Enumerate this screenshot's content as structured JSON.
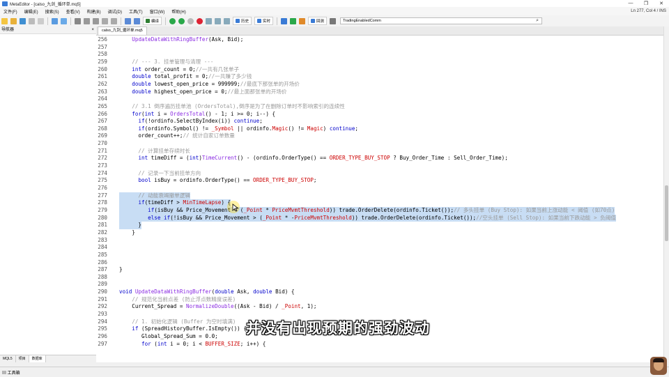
{
  "window": {
    "title": "MetaEditor - [calso_九剑_循环单.mq5]",
    "controls": [
      "—",
      "❐",
      "✕"
    ]
  },
  "menu": {
    "items": [
      "文件(F)",
      "编辑(E)",
      "搜索(S)",
      "查看(V)",
      "构建(B)",
      "调试(D)",
      "工具(T)",
      "窗口(W)",
      "帮助(H)"
    ],
    "cursor_status": "Ln 277, Col 4  /  INS"
  },
  "toolbar": {
    "compile_label": "编译",
    "history_label": "历史",
    "realtime_label": "实时",
    "trade_label": "回测",
    "search_value": "TradingEnabledComm"
  },
  "navigator": {
    "title": "导航器",
    "tabs": [
      "MQL5",
      "项目",
      "数据库"
    ]
  },
  "editor": {
    "tab_label": "calso_九剑_循环单.mq5",
    "lines": [
      {
        "n": "256",
        "t": "    UpdateDataWithRingBuffer(Ask, Bid);",
        "cls": ""
      },
      {
        "n": "257",
        "t": "",
        "cls": ""
      },
      {
        "n": "258",
        "t": "",
        "cls": ""
      },
      {
        "n": "259",
        "t": "    // --- 3. 挂单管理与清理 ---",
        "cls": "c"
      },
      {
        "n": "260",
        "t": "    int order_count = 0;//一共有几张单子",
        "cls": "mix1"
      },
      {
        "n": "261",
        "t": "    double total_profit = 0;//一共赚了多少钱",
        "cls": "mix2"
      },
      {
        "n": "262",
        "t": "    double lowest_open_price = 999999;//最底下那张单的开场价",
        "cls": "mix3"
      },
      {
        "n": "263",
        "t": "    double highest_open_price = 0;//最上面那张单的开场价",
        "cls": "mix4"
      },
      {
        "n": "264",
        "t": "",
        "cls": ""
      },
      {
        "n": "265",
        "t": "    // 3.1 倒序遍历挂单池 (OrdersTotal),倒序是为了在删除订单时不影响索引的连续性",
        "cls": "c"
      },
      {
        "n": "266",
        "t": "    for(int i = OrdersTotal() - 1; i >= 0; i--) {",
        "cls": "mix5"
      },
      {
        "n": "267",
        "t": "      if(!ordinfo.SelectByIndex(i)) continue;",
        "cls": "mix6"
      },
      {
        "n": "268",
        "t": "      if(ordinfo.Symbol() != _Symbol || ordinfo.Magic() != Magic) continue;",
        "cls": "mix7"
      },
      {
        "n": "269",
        "t": "      order_count++;// 统计自家订单数量",
        "cls": "mix8"
      },
      {
        "n": "270",
        "t": "",
        "cls": ""
      },
      {
        "n": "271",
        "t": "      // 计算挂单存续时长",
        "cls": "c"
      },
      {
        "n": "272",
        "t": "      int timeDiff = (int)TimeCurrent() - (ordinfo.OrderType() == ORDER_TYPE_BUY_STOP ? Buy_Order_Time : Sell_Order_Time);",
        "cls": "mix9"
      },
      {
        "n": "273",
        "t": "",
        "cls": ""
      },
      {
        "n": "274",
        "t": "      // 记录一下当前挂单方向",
        "cls": "c"
      },
      {
        "n": "275",
        "t": "      bool isBuy = ordinfo.OrderType() == ORDER_TYPE_BUY_STOP;",
        "cls": "mix10"
      },
      {
        "n": "276",
        "t": "",
        "cls": ""
      },
      {
        "n": "277",
        "t": "      // 动能衰竭撤单逻辑",
        "cls": "selc"
      },
      {
        "n": "278",
        "t": "      if(timeDiff > MinTimeLapse) {",
        "cls": "sel"
      },
      {
        "n": "279",
        "t": "         if(isBuy && Price_Movement < (_Point * PriceMvmtThreshold)) trade.OrderDelete(ordinfo.Ticket());// 多头挂单 (Buy Stop): 如果当前上涨动能 < 阈值 (如70点)",
        "cls": "sel"
      },
      {
        "n": "280",
        "t": "         else if(!isBuy && Price_Movement > (_Point * -PriceMvmtThreshold)) trade.OrderDelete(ordinfo.Ticket());//空头挂单 (Sell Stop): 如果当前下跌动能 > 负阈值",
        "cls": "sel"
      },
      {
        "n": "281",
        "t": "      }",
        "cls": "sel"
      },
      {
        "n": "282",
        "t": "    }",
        "cls": ""
      },
      {
        "n": "283",
        "t": "",
        "cls": ""
      },
      {
        "n": "284",
        "t": "",
        "cls": ""
      },
      {
        "n": "285",
        "t": "",
        "cls": ""
      },
      {
        "n": "286",
        "t": "",
        "cls": ""
      },
      {
        "n": "287",
        "t": "}",
        "cls": ""
      },
      {
        "n": "288",
        "t": "",
        "cls": ""
      },
      {
        "n": "289",
        "t": "",
        "cls": ""
      },
      {
        "n": "290",
        "t": "void UpdateDataWithRingBuffer(double Ask, double Bid) {",
        "cls": "mix11"
      },
      {
        "n": "291",
        "t": "    // 规范化当前点差 (防止浮点数精度误差)",
        "cls": "c"
      },
      {
        "n": "292",
        "t": "    Current_Spread = NormalizeDouble((Ask - Bid) / _Point, 1);",
        "cls": "mix12"
      },
      {
        "n": "293",
        "t": "",
        "cls": ""
      },
      {
        "n": "294",
        "t": "    // 1. 初始化逻辑 (Buffer 为空时填满)",
        "cls": "c"
      },
      {
        "n": "295",
        "t": "    if (SpreadHistoryBuffer.IsEmpty()) {",
        "cls": "mix13"
      },
      {
        "n": "296",
        "t": "       Global_Spread_Sum = 0.0;",
        "cls": "mix14"
      },
      {
        "n": "297",
        "t": "       for (int i = 0; i < BUFFER_SIZE; i++) {",
        "cls": "mix15"
      }
    ]
  },
  "statusbar": {
    "tool_label": "工具箱"
  },
  "subtitle": "并没有出现预期的强劲波动",
  "colors": {
    "keyword": "#0000cc",
    "comment": "#999999",
    "function": "#8a2be2",
    "constant": "#cc0000",
    "selection": "#c8ddf4"
  }
}
